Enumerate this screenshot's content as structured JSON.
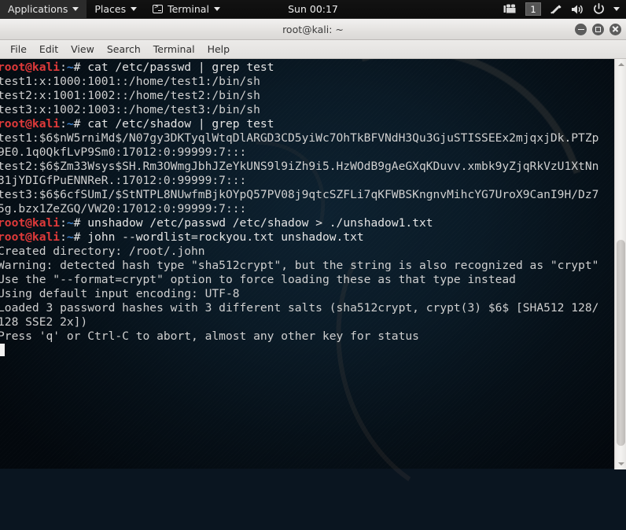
{
  "panel": {
    "applications_label": "Applications",
    "places_label": "Places",
    "terminal_label": "Terminal",
    "clock": "Sun 00:17",
    "workspace": "1",
    "icons": {
      "applications_caret": "chevron-down-icon",
      "places_caret": "chevron-down-icon",
      "terminal_glyph": "terminal-icon",
      "terminal_caret": "chevron-down-icon",
      "recorder": "screen-recorder-icon",
      "network": "network-icon",
      "volume": "volume-icon",
      "power": "power-icon",
      "tray_caret": "chevron-down-icon"
    }
  },
  "window": {
    "title": "root@kali: ~",
    "buttons": {
      "minimize": "minimize-button",
      "maximize": "maximize-button",
      "close": "close-button"
    }
  },
  "menubar": {
    "items": [
      "File",
      "Edit",
      "View",
      "Search",
      "Terminal",
      "Help"
    ]
  },
  "terminal": {
    "prompt": {
      "user_host": "root@kali",
      "colon": ":",
      "path": "~",
      "sigil": "#"
    },
    "lines": [
      {
        "type": "prompt",
        "command": " cat /etc/passwd | grep test"
      },
      {
        "type": "output",
        "text": "test1:x:1000:1001::/home/test1:/bin/sh"
      },
      {
        "type": "output",
        "text": "test2:x:1001:1002::/home/test2:/bin/sh"
      },
      {
        "type": "output",
        "text": "test3:x:1002:1003::/home/test3:/bin/sh"
      },
      {
        "type": "prompt",
        "command": " cat /etc/shadow | grep test"
      },
      {
        "type": "output",
        "text": "test1:$6$nW5rniMd$/N07gy3DKTyqlWtqDlARGD3CD5yiWc7OhTkBFVNdH3Qu3GjuSTISSEEx2mjqxjDk.PTZp"
      },
      {
        "type": "output",
        "text": "9E0.1q0QkfLvP9Sm0:17012:0:99999:7:::"
      },
      {
        "type": "output",
        "text": "test2:$6$Zm33Wsys$SH.Rm3OWmgJbhJZeYkUNS9l9iZh9i5.HzWOdB9gAeGXqKDuvv.xmbk9yZjqRkVzU1XtNn"
      },
      {
        "type": "output",
        "text": "31jYDIGfPuENNReR.:17012:0:99999:7:::"
      },
      {
        "type": "output",
        "text": "test3:$6$6cfSUmI/$StNTPL8NUwfmBjkOYpQ57PV08j9qtcSZFLi7qKFWBSKngnvMihcYG7UroX9CanI9H/Dz7"
      },
      {
        "type": "output",
        "text": "5g.bzx1ZeZGQ/VW20:17012:0:99999:7:::"
      },
      {
        "type": "prompt",
        "command": " unshadow /etc/passwd /etc/shadow > ./unshadow1.txt"
      },
      {
        "type": "prompt",
        "command": " john --wordlist=rockyou.txt unshadow.txt"
      },
      {
        "type": "output",
        "text": "Created directory: /root/.john"
      },
      {
        "type": "output",
        "text": "Warning: detected hash type \"sha512crypt\", but the string is also recognized as \"crypt\""
      },
      {
        "type": "output",
        "text": "Use the \"--format=crypt\" option to force loading these as that type instead"
      },
      {
        "type": "output",
        "text": "Using default input encoding: UTF-8"
      },
      {
        "type": "output",
        "text": "Loaded 3 password hashes with 3 different salts (sha512crypt, crypt(3) $6$ [SHA512 128/"
      },
      {
        "type": "output",
        "text": "128 SSE2 2x])"
      },
      {
        "type": "output",
        "text": "Press 'q' or Ctrl-C to abort, almost any other key for status"
      },
      {
        "type": "cursor",
        "text": ""
      }
    ]
  },
  "scrollbar": {
    "up_arrow": "scroll-up-arrow",
    "down_arrow": "scroll-down-arrow",
    "thumb": "scrollbar-thumb"
  },
  "colors": {
    "prompt_red": "#e03a3a",
    "prompt_blue": "#3a7ecb",
    "terminal_fg": "#d6d6d6",
    "panel_bg": "#0c0c0c",
    "titlebar_bg": "#e4e2e0"
  }
}
